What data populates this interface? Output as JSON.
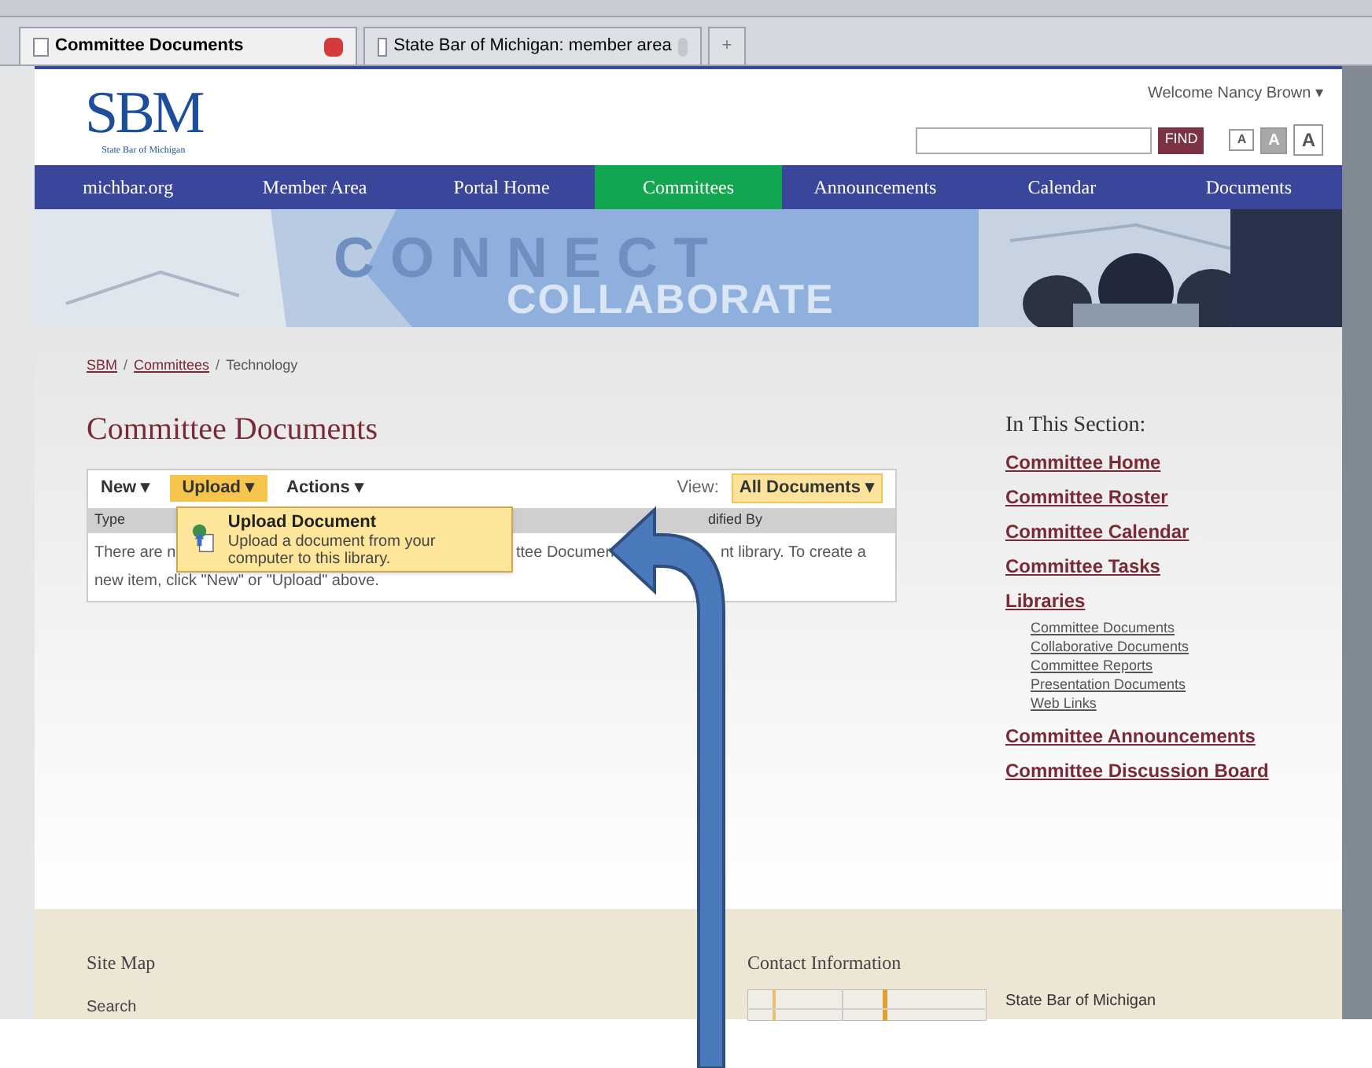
{
  "browser_tabs": [
    {
      "title": "Committee Documents",
      "selected": true
    },
    {
      "title": "State Bar of Michigan: member area",
      "selected": false
    }
  ],
  "new_tab": "+",
  "header": {
    "logo": "SBM",
    "logo_subtitle": "State Bar of Michigan",
    "welcome": "Welcome Nancy Brown",
    "welcome_caret": "▾",
    "search_button": "FIND",
    "text_sizes": [
      {
        "label": "A",
        "selected": false
      },
      {
        "label": "A",
        "selected": true
      },
      {
        "label": "A",
        "selected": false
      }
    ]
  },
  "nav": [
    {
      "label": "michbar.org",
      "selected": false
    },
    {
      "label": "Member Area",
      "selected": false
    },
    {
      "label": "Portal Home",
      "selected": false
    },
    {
      "label": "Committees",
      "selected": true
    },
    {
      "label": "Announcements",
      "selected": false
    },
    {
      "label": "Calendar",
      "selected": false
    },
    {
      "label": "Documents",
      "selected": false
    }
  ],
  "banner": {
    "kind": "picture",
    "headline": "CONNECT",
    "subline": "COLLABORATE"
  },
  "breadcrumb": [
    {
      "label": "SBM",
      "link": true
    },
    {
      "label": "Committees",
      "link": true
    },
    {
      "label": "Technology",
      "link": false
    }
  ],
  "breadcrumb_separators": [
    "/",
    "/"
  ],
  "page_title": "Committee Documents",
  "toolbar": {
    "new": "New",
    "new_caret": "▾",
    "upload": "Upload",
    "upload_caret": "▾",
    "actions": "Actions",
    "actions_caret": "▾",
    "view_label": "View:",
    "view": "All Documents",
    "view_caret": "▾"
  },
  "upload_menu": {
    "title": "Upload Document",
    "description": "Upload a document from your computer to this library."
  },
  "table": {
    "columns": [
      "Type",
      "dified By"
    ],
    "message_parts": [
      "There are n",
      "ttee Documen",
      "nt library. To create a"
    ],
    "message_line_2": "new item, click \"New\" or \"Upload\" above."
  },
  "sidebar": {
    "heading": "In This Section:",
    "items": [
      {
        "label": "Committee Home"
      },
      {
        "label": "Committee Roster"
      },
      {
        "label": "Committee Calendar"
      },
      {
        "label": "Committee Tasks"
      },
      {
        "label": "Libraries",
        "children": [
          {
            "label": "Committee Documents"
          },
          {
            "label": "Collaborative Documents"
          },
          {
            "label": "Committee Reports"
          },
          {
            "label": "Presentation Documents"
          },
          {
            "label": "Web Links"
          }
        ]
      },
      {
        "label": "Committee Announcements"
      },
      {
        "label": "Committee Discussion Board"
      }
    ]
  },
  "footer": {
    "site_map": "Site Map",
    "site_map_links": [
      "Search"
    ],
    "contact": "Contact Information",
    "address": "State Bar of Michigan"
  }
}
